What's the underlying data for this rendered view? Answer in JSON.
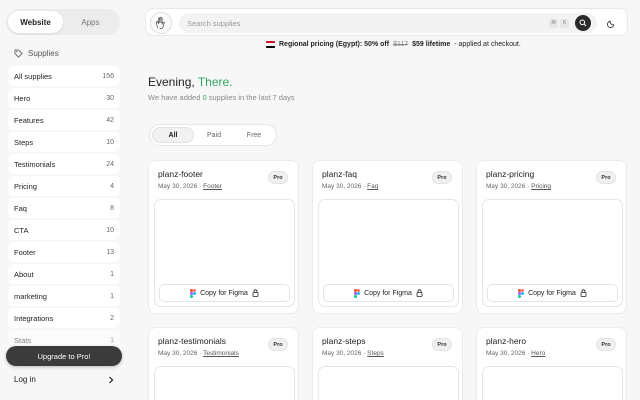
{
  "tabs": [
    {
      "label": "Website",
      "active": true
    },
    {
      "label": "Apps",
      "active": false
    }
  ],
  "sidebar": {
    "section_label": "Supplies",
    "items": [
      {
        "label": "All supplies",
        "count": "156"
      },
      {
        "label": "Hero",
        "count": "30"
      },
      {
        "label": "Features",
        "count": "42"
      },
      {
        "label": "Steps",
        "count": "10"
      },
      {
        "label": "Testimonials",
        "count": "24"
      },
      {
        "label": "Pricing",
        "count": "4"
      },
      {
        "label": "Faq",
        "count": "8"
      },
      {
        "label": "CTA",
        "count": "10"
      },
      {
        "label": "Footer",
        "count": "13"
      },
      {
        "label": "About",
        "count": "1"
      },
      {
        "label": "marketing",
        "count": "1"
      },
      {
        "label": "Integrations",
        "count": "2"
      },
      {
        "label": "Stats",
        "count": "1"
      }
    ],
    "upgrade_label": "Upgrade to Pro!",
    "login_label": "Log in"
  },
  "search": {
    "placeholder": "Search supplies",
    "value": ""
  },
  "promo": {
    "prefix": "Regional pricing (Egypt): 50% off",
    "old_price": "$117",
    "new_price": "$59 lifetime",
    "suffix": "- applied at checkout."
  },
  "greeting": {
    "text": "Evening,",
    "name": "There."
  },
  "subtitle": {
    "before": "We have added",
    "count": "0",
    "after": "supplies in the last 7 days"
  },
  "filters": [
    {
      "label": "All",
      "active": true
    },
    {
      "label": "Paid",
      "active": false
    },
    {
      "label": "Free",
      "active": false
    }
  ],
  "cards": [
    {
      "title": "planz-footer",
      "date": "May 30, 2026",
      "category": "Footer",
      "badge": "Pro",
      "action": "Copy for Figma"
    },
    {
      "title": "planz-faq",
      "date": "May 30, 2026",
      "category": "Faq",
      "badge": "Pro",
      "action": "Copy for Figma"
    },
    {
      "title": "planz-pricing",
      "date": "May 30, 2026",
      "category": "Pricing",
      "badge": "Pro",
      "action": "Copy for Figma"
    },
    {
      "title": "planz-testimonials",
      "date": "May 30, 2026",
      "category": "Testimonials",
      "badge": "Pro",
      "action": "Copy for Figma"
    },
    {
      "title": "planz-steps",
      "date": "May 30, 2026",
      "category": "Steps",
      "badge": "Pro",
      "action": "Copy for Figma"
    },
    {
      "title": "planz-hero",
      "date": "May 30, 2026",
      "category": "Hero",
      "badge": "Pro",
      "action": "Copy for Figma"
    }
  ],
  "colors": {
    "accent": "#2ea85a",
    "dark_button": "#3b3b3b",
    "background": "#f7f7f7"
  },
  "icons": {
    "section": "tag-icon",
    "search": "search-icon",
    "theme": "moon-icon",
    "lock": "lock-icon",
    "figma": "figma-icon",
    "login": "chevron-right-icon"
  }
}
